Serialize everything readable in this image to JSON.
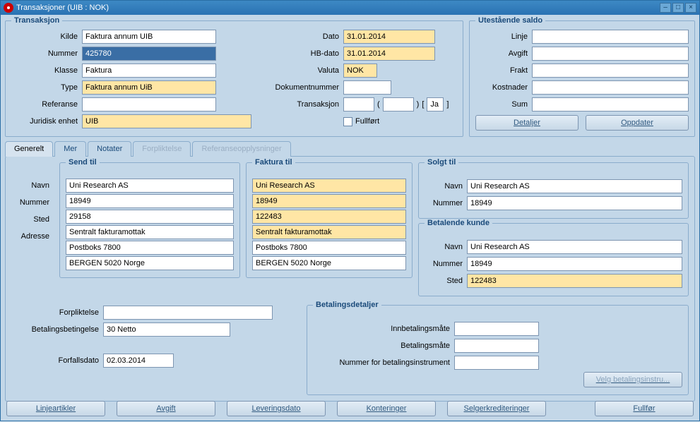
{
  "window": {
    "title": "Transaksjoner (UIB : NOK)"
  },
  "transaksjon": {
    "legend": "Transaksjon",
    "kilde_label": "Kilde",
    "kilde": "Faktura annum UIB",
    "nummer_label": "Nummer",
    "nummer": "425780",
    "klasse_label": "Klasse",
    "klasse": "Faktura",
    "type_label": "Type",
    "type": "Faktura annum UiB",
    "referanse_label": "Referanse",
    "referanse": "",
    "juridisk_label": "Juridisk enhet",
    "juridisk": "UIB",
    "dato_label": "Dato",
    "dato": "31.01.2014",
    "hbdato_label": "HB-dato",
    "hbdato": "31.01.2014",
    "valuta_label": "Valuta",
    "valuta": "NOK",
    "doknr_label": "Dokumentnummer",
    "doknr": "",
    "trans_label": "Transaksjon",
    "trans1": "",
    "trans2": "",
    "trans_ja": "Ja",
    "fullfort_label": "Fullført"
  },
  "utestaende": {
    "legend": "Utestående saldo",
    "linje_label": "Linje",
    "linje": "",
    "avgift_label": "Avgift",
    "avgift": "",
    "frakt_label": "Frakt",
    "frakt": "",
    "kostnader_label": "Kostnader",
    "kostnader": "",
    "sum_label": "Sum",
    "sum": "",
    "detaljer_btn": "Detaljer",
    "oppdater_btn": "Oppdater"
  },
  "tabs": {
    "generelt": "Generelt",
    "mer": "Mer",
    "notater": "Notater",
    "forpliktelse": "Forpliktelse",
    "ref": "Referanseopplysninger"
  },
  "sendtil": {
    "legend": "Send til",
    "navn_label": "Navn",
    "navn": "Uni Research AS",
    "nummer_label": "Nummer",
    "nummer": "18949",
    "sted_label": "Sted",
    "sted": "29158",
    "adresse_label": "Adresse",
    "adresse1": "Sentralt fakturamottak",
    "adresse2": "Postboks 7800",
    "adresse3": "BERGEN 5020 Norge"
  },
  "fakturatil": {
    "legend": "Faktura til",
    "navn": "Uni Research AS",
    "nummer": "18949",
    "sted": "122483",
    "adresse1": "Sentralt fakturamottak",
    "adresse2": "Postboks 7800",
    "adresse3": "BERGEN 5020 Norge"
  },
  "solgttil": {
    "legend": "Solgt til",
    "navn_label": "Navn",
    "navn": "Uni Research AS",
    "nummer_label": "Nummer",
    "nummer": "18949"
  },
  "betalende": {
    "legend": "Betalende kunde",
    "navn_label": "Navn",
    "navn": "Uni Research AS",
    "nummer_label": "Nummer",
    "nummer": "18949",
    "sted_label": "Sted",
    "sted": "122483"
  },
  "lower_left": {
    "forpliktelse_label": "Forpliktelse",
    "forpliktelse": "",
    "bet_label": "Betalingsbetingelse",
    "bet": "30 Netto",
    "forfall_label": "Forfallsdato",
    "forfall": "02.03.2014"
  },
  "betdetaljer": {
    "legend": "Betalingsdetaljer",
    "innbet_label": "Innbetalingsmåte",
    "innbet": "",
    "betmate_label": "Betalingsmåte",
    "betmate": "",
    "instr_label": "Nummer for betalingsinstrument",
    "instr": "",
    "velg_btn": "Velg betalingsinstru..."
  },
  "footer": {
    "linjeartikler": "Linjeartikler",
    "avgift": "Avgift",
    "leveringsdato": "Leveringsdato",
    "konteringer": "Konteringer",
    "selger": "Selgerkrediteringer",
    "fullfor": "Fullfør"
  }
}
